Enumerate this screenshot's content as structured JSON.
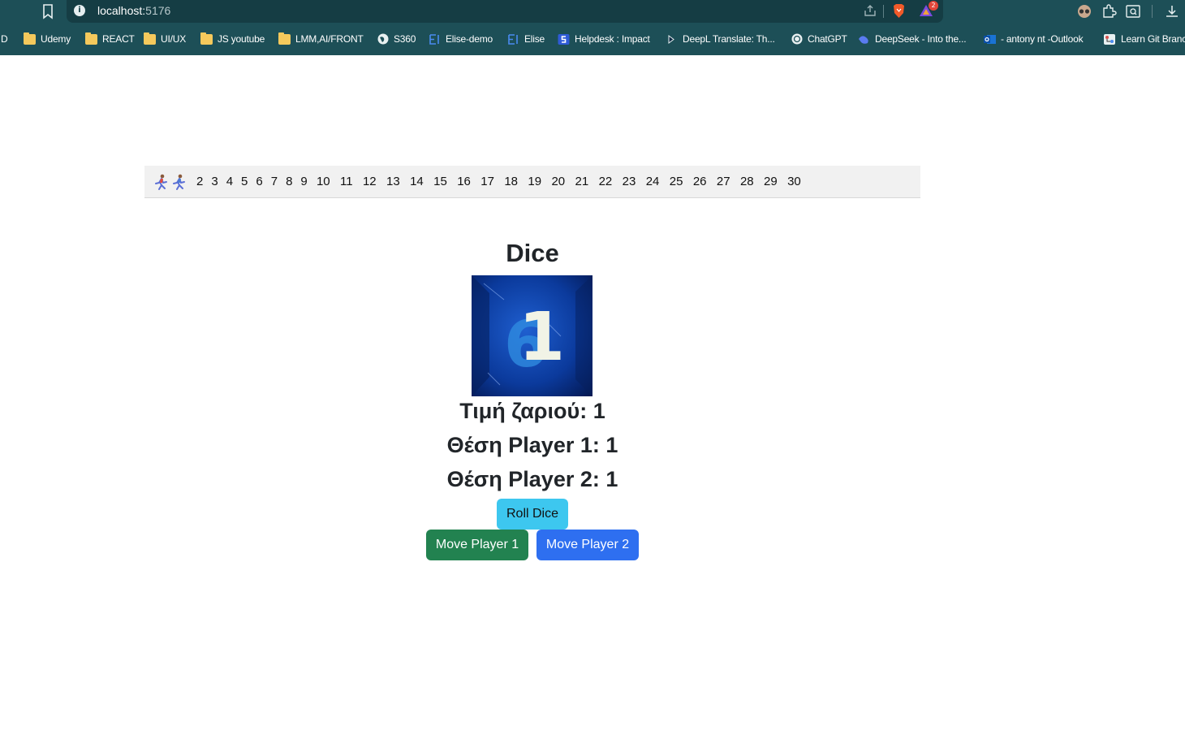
{
  "browser": {
    "url_host": "localhost:",
    "url_port": "5176",
    "notification_count": "2",
    "bookmarks": [
      {
        "label": "D",
        "icon": "none"
      },
      {
        "label": "Udemy",
        "icon": "folder-icon"
      },
      {
        "label": "REACT",
        "icon": "folder-icon"
      },
      {
        "label": "UI/UX",
        "icon": "folder-icon"
      },
      {
        "label": "JS youtube",
        "icon": "folder-icon"
      },
      {
        "label": "LMM,AI/FRONT",
        "icon": "folder-icon"
      },
      {
        "label": "S360",
        "icon": "globe-icon"
      },
      {
        "label": "Elise-demo",
        "icon": "elise-icon"
      },
      {
        "label": "Elise",
        "icon": "elise-icon"
      },
      {
        "label": "Helpdesk : Impact",
        "icon": "helpdesk-icon"
      },
      {
        "label": "DeepL Translate: Th...",
        "icon": "deepl-icon"
      },
      {
        "label": "ChatGPT",
        "icon": "chatgpt-icon"
      },
      {
        "label": "DeepSeek - Into the...",
        "icon": "deepseek-icon"
      },
      {
        "label": "- antony nt -Outlook",
        "icon": "outlook-icon"
      },
      {
        "label": "Learn Git Branc",
        "icon": "git-icon"
      }
    ]
  },
  "board": {
    "cells": [
      "2",
      "3",
      "4",
      "5",
      "6",
      "7",
      "8",
      "9",
      "10",
      "11",
      "12",
      "13",
      "14",
      "15",
      "16",
      "17",
      "18",
      "19",
      "20",
      "21",
      "22",
      "23",
      "24",
      "25",
      "26",
      "27",
      "28",
      "29",
      "30"
    ],
    "player_markers": [
      "runner-icon",
      "runner-icon"
    ]
  },
  "game": {
    "title": "Dice",
    "dice_value_text": "Τιμή ζαριού: 1",
    "player1_position_text": "Θέση Player 1: 1",
    "player2_position_text": "Θέση Player 2: 1",
    "dice_face": "1",
    "roll_button": "Roll Dice",
    "move_p1_button": "Move Player 1",
    "move_p2_button": "Move Player 2"
  },
  "colors": {
    "chrome_bg": "#1d4f57",
    "roll_button": "#3dc7ef",
    "move_p1_button": "#228250",
    "move_p2_button": "#2e6ff0"
  }
}
